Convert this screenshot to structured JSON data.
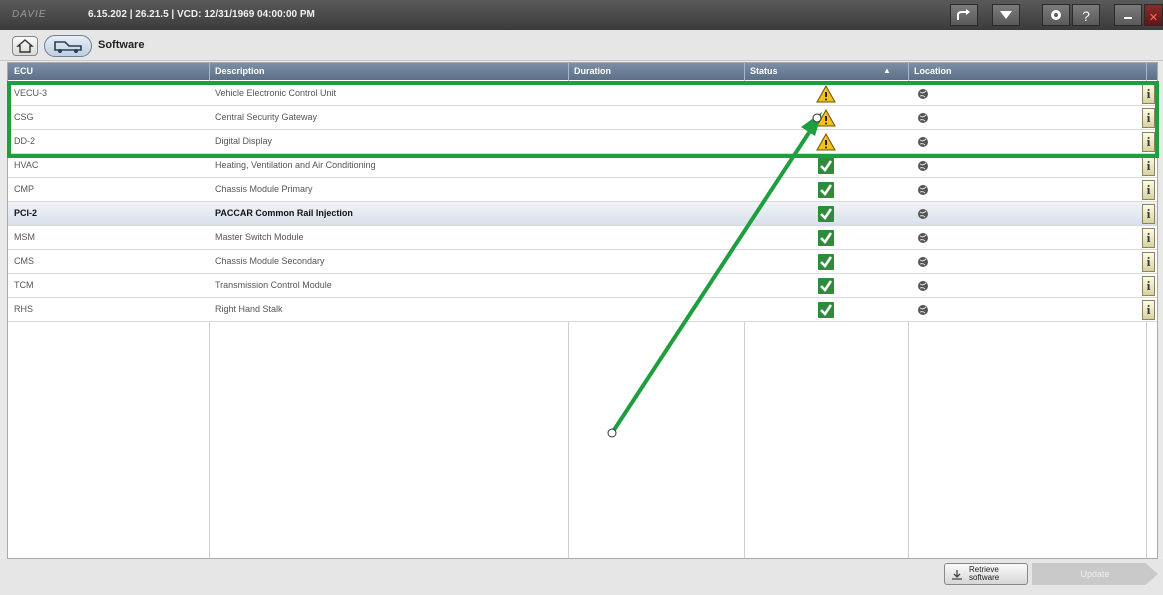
{
  "titlebar": {
    "logo": "DAVIE",
    "title": "6.15.202 | 26.21.5 | VCD: 12/31/1969 04:00:00 PM",
    "buttons": [
      "forward-icon",
      "dropdown-icon",
      "settings-icon",
      "help",
      "minimize",
      "close"
    ]
  },
  "breadcrumb": {
    "label": "Software"
  },
  "table": {
    "columns": [
      "ECU",
      "Description",
      "Duration",
      "Status",
      "Location"
    ],
    "rows": [
      {
        "ecu": "VECU-3",
        "description": "Vehicle Electronic Control Unit",
        "duration": "",
        "status": "warning",
        "location": "globe",
        "info": "i"
      },
      {
        "ecu": "CSG",
        "description": "Central Security Gateway",
        "duration": "",
        "status": "warning",
        "location": "globe",
        "info": "i"
      },
      {
        "ecu": "DD-2",
        "description": "Digital Display",
        "duration": "",
        "status": "warning",
        "location": "globe",
        "info": "i"
      },
      {
        "ecu": "HVAC",
        "description": "Heating, Ventilation and Air Conditioning",
        "duration": "",
        "status": "ok",
        "location": "globe",
        "info": "i"
      },
      {
        "ecu": "CMP",
        "description": "Chassis Module Primary",
        "duration": "",
        "status": "ok",
        "location": "globe",
        "info": "i"
      },
      {
        "ecu": "PCI-2",
        "description": "PACCAR Common Rail Injection",
        "duration": "",
        "status": "ok",
        "location": "globe",
        "info": "i",
        "selected": true
      },
      {
        "ecu": "MSM",
        "description": "Master Switch Module",
        "duration": "",
        "status": "ok",
        "location": "globe",
        "info": "i"
      },
      {
        "ecu": "CMS",
        "description": "Chassis Module Secondary",
        "duration": "",
        "status": "ok",
        "location": "globe",
        "info": "i"
      },
      {
        "ecu": "TCM",
        "description": "Transmission Control Module",
        "duration": "",
        "status": "ok",
        "location": "globe",
        "info": "i"
      },
      {
        "ecu": "RHS",
        "description": "Right Hand Stalk",
        "duration": "",
        "status": "ok",
        "location": "globe",
        "info": "i"
      }
    ]
  },
  "footer": {
    "retrieve_label": "Retrieve\nsoftware",
    "update_label": "Update"
  },
  "colors": {
    "header": "#6b7f97",
    "highlight": "#1e9e3e",
    "ok_green": "#2e8b3a",
    "warning_yellow": "#f2c21b"
  }
}
